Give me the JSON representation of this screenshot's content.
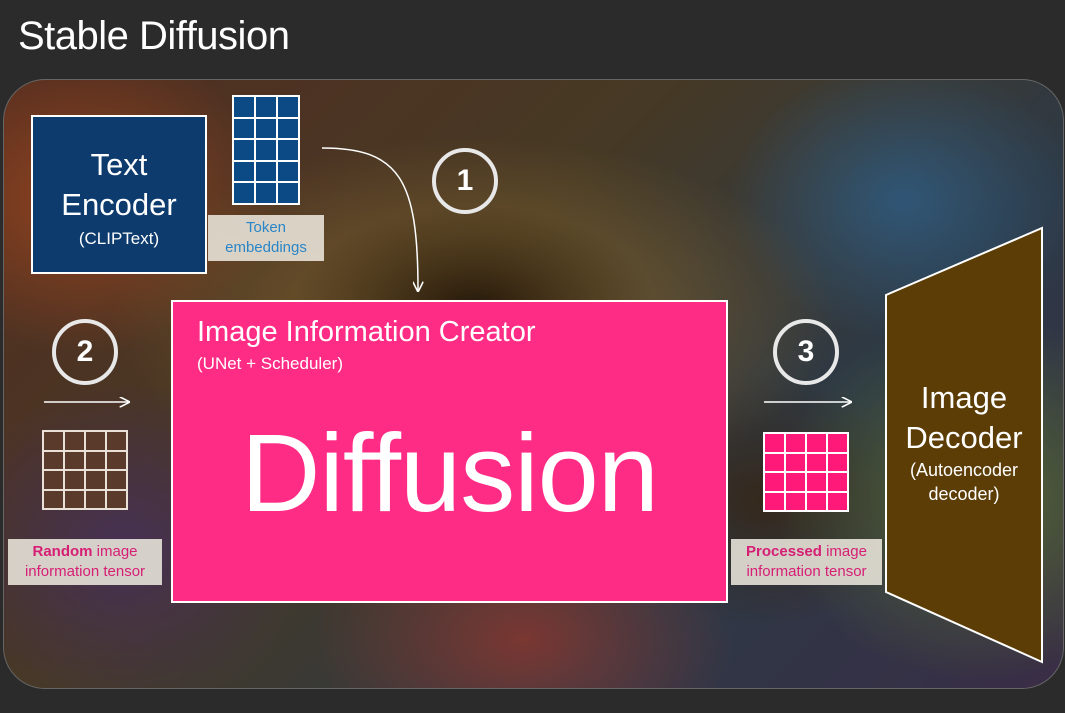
{
  "title": "Stable Diffusion",
  "text_encoder": {
    "line1": "Text",
    "line2": "Encoder",
    "sub": "(CLIPText)"
  },
  "token_label": {
    "line1": "Token",
    "line2": "embeddings"
  },
  "steps": [
    "1",
    "2",
    "3"
  ],
  "creator": {
    "title": "Image Information Creator",
    "sub": "(UNet + Scheduler)",
    "big": "Diffusion"
  },
  "random_label": {
    "bold": "Random",
    "rest": " image",
    "line2": "information tensor"
  },
  "processed_label": {
    "bold": "Processed",
    "rest": " image",
    "line2": "information tensor"
  },
  "decoder": {
    "line1": "Image",
    "line2": "Decoder",
    "line3": "(Autoencoder",
    "line4": "decoder)"
  },
  "colors": {
    "text_encoder": "#0d3b6e",
    "creator": "#ff2c85",
    "decoder": "#5c3d06",
    "token_cell": "#0c4a86",
    "processed_cell": "#ff1a7a",
    "random_cell": "#5a3a2a"
  }
}
